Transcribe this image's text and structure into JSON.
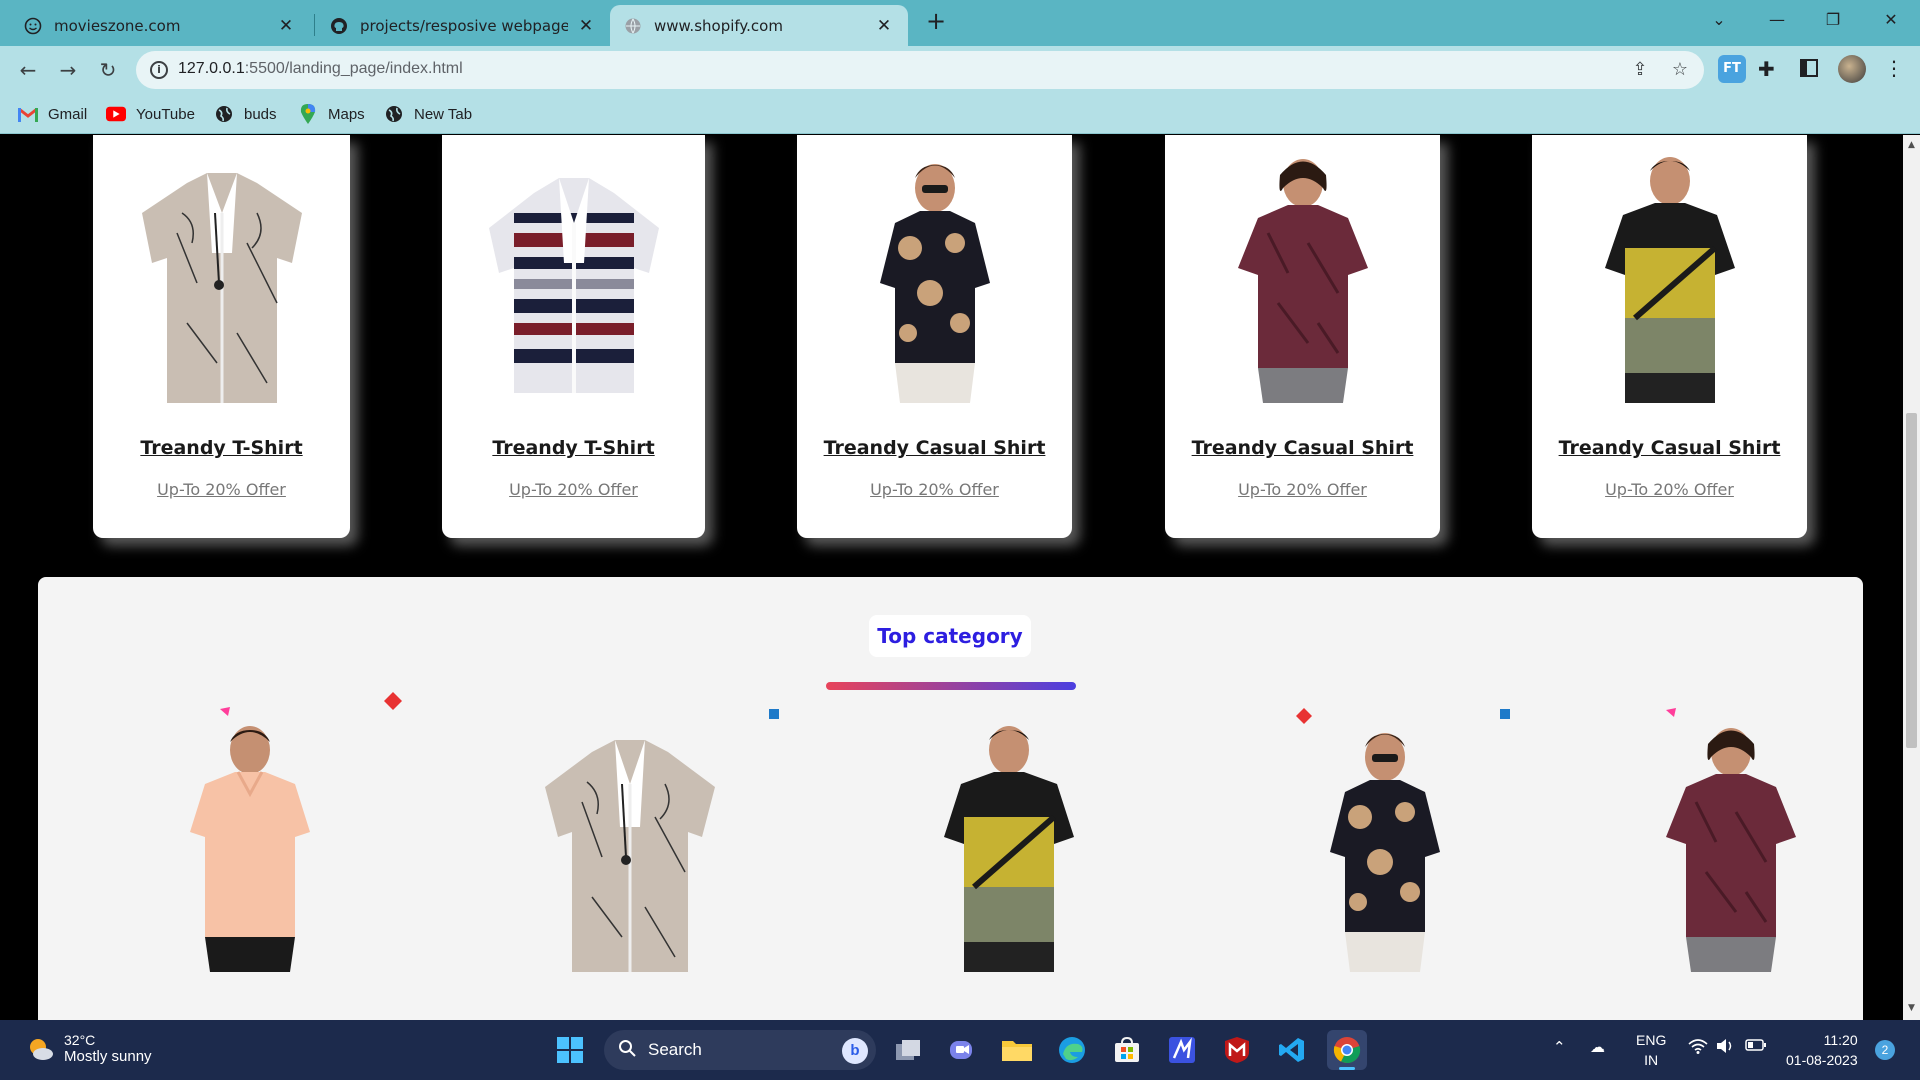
{
  "tabs": [
    {
      "title": "movieszone.com",
      "icon": "smiley-icon"
    },
    {
      "title": "projects/resposive webpage/inde",
      "icon": "github-icon"
    },
    {
      "title": "www.shopify.com",
      "icon": "globe-icon"
    }
  ],
  "address": {
    "host": "127.0.0.1",
    "rest": ":5500/landing_page/index.html"
  },
  "bookmarks": [
    {
      "label": "Gmail",
      "icon": "gmail-icon"
    },
    {
      "label": "YouTube",
      "icon": "youtube-icon"
    },
    {
      "label": "buds",
      "icon": "globe-icon"
    },
    {
      "label": "Maps",
      "icon": "maps-icon"
    },
    {
      "label": "New Tab",
      "icon": "globe-icon"
    }
  ],
  "products": [
    {
      "name": "Treandy T-Shirt",
      "offer": "Up-To 20% Offer",
      "image": "printed-shirt"
    },
    {
      "name": "Treandy T-Shirt",
      "offer": "Up-To 20% Offer",
      "image": "striped-shirt"
    },
    {
      "name": "Treandy Casual Shirt",
      "offer": "Up-To 20% Offer",
      "image": "floral-shirt-model"
    },
    {
      "name": "Treandy Casual Shirt",
      "offer": "Up-To 20% Offer",
      "image": "maroon-tshirt-model"
    },
    {
      "name": "Treandy Casual Shirt",
      "offer": "Up-To 20% Offer",
      "image": "olive-tshirt-model"
    }
  ],
  "top_category": {
    "title": "Top category",
    "accent_start": "#e8435a",
    "accent_end": "#4b3fe0",
    "items": [
      "peach-polo-model",
      "printed-shirt",
      "olive-tshirt-model",
      "floral-shirt-model",
      "maroon-tshirt-model"
    ]
  },
  "taskbar": {
    "temperature": "32°C",
    "weather": "Mostly sunny",
    "search_label": "Search",
    "lang_1": "ENG",
    "lang_2": "IN",
    "time": "11:20",
    "date": "01-08-2023",
    "notifications": "2"
  }
}
